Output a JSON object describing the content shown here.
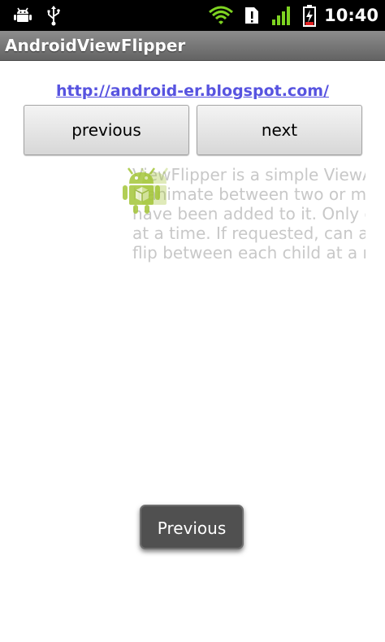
{
  "status_bar": {
    "time": "10:40",
    "icons": [
      "android-debug-icon",
      "usb-icon",
      "wifi-icon",
      "sim-alert-icon",
      "signal-icon",
      "battery-charging-icon"
    ]
  },
  "app": {
    "title": "AndroidViewFlipper"
  },
  "content": {
    "link_text": "http://android-er.blogspot.com/",
    "buttons": {
      "previous": "previous",
      "next": "next"
    },
    "flipper_lines": [
      "ViewFlipper is a simple ViewA",
      "ll animate between two or m",
      "have been added to it. Only on",
      "at a time. If requested, can aut",
      "flip between each child at a regu"
    ]
  },
  "toast": {
    "text": "Previous"
  },
  "colors": {
    "link": "#5753e0",
    "android_green": "#a4c639",
    "wifi_green": "#7ed321",
    "battery_red": "#e02020"
  }
}
